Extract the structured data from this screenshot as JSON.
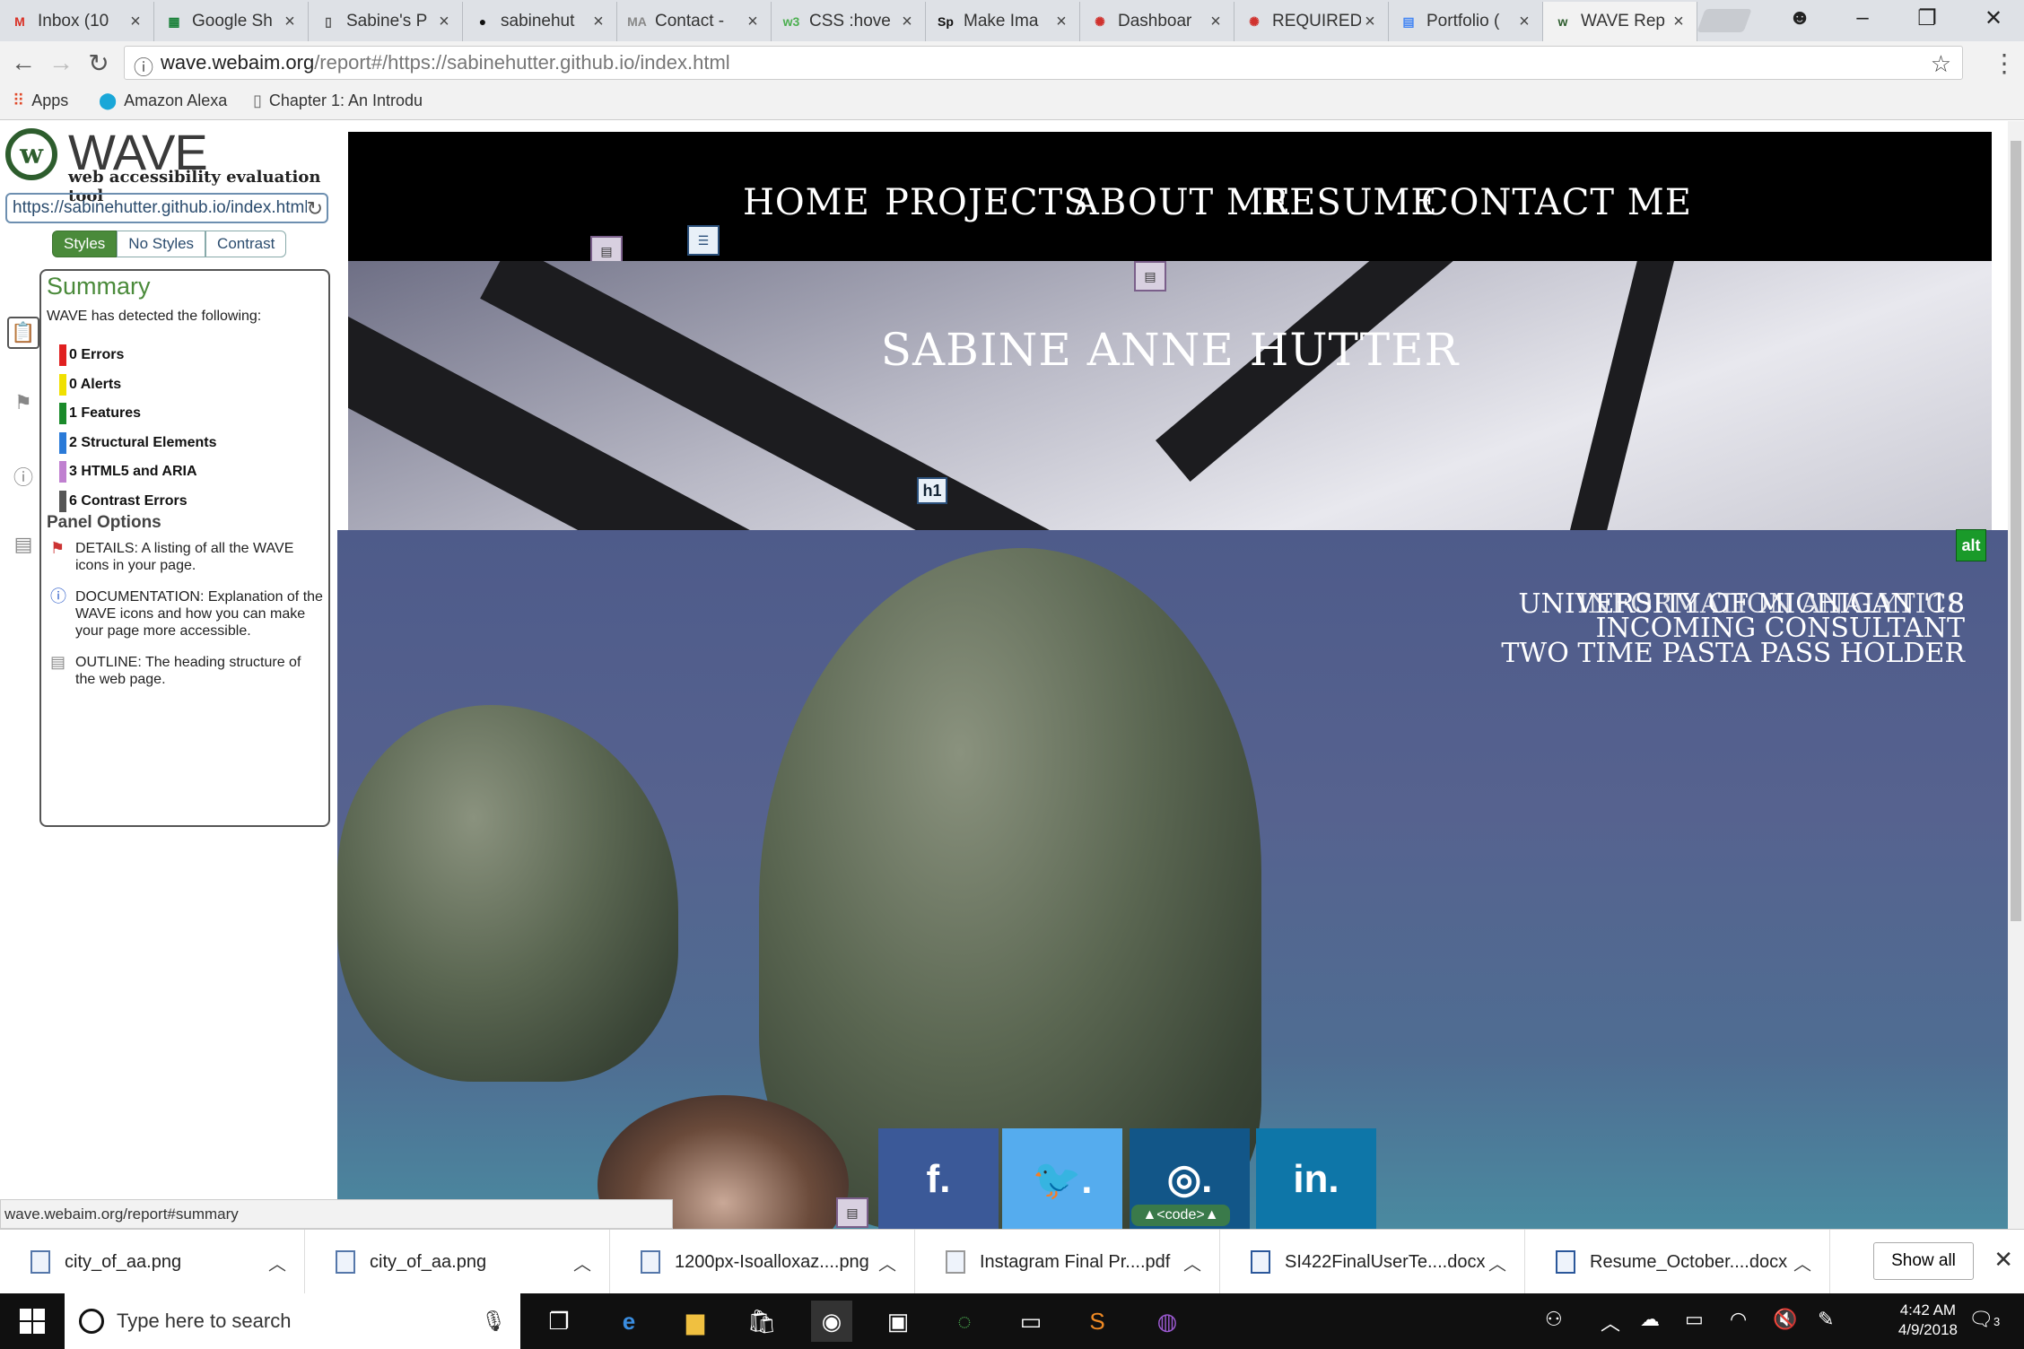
{
  "browser": {
    "tabs": [
      {
        "label": "Inbox (10",
        "icon": "gmail-icon",
        "color": "#d93025",
        "glyph": "M"
      },
      {
        "label": "Google Sh",
        "icon": "sheets-icon",
        "color": "#188038",
        "glyph": "▦"
      },
      {
        "label": "Sabine's P",
        "icon": "page-icon",
        "color": "#555555",
        "glyph": "▯"
      },
      {
        "label": "sabinehut",
        "icon": "github-icon",
        "color": "#111111",
        "glyph": "●"
      },
      {
        "label": "Contact -",
        "icon": "ma-icon",
        "color": "#888888",
        "glyph": "MA"
      },
      {
        "label": "CSS :hove",
        "icon": "w3-icon",
        "color": "#4caf50",
        "glyph": "w3"
      },
      {
        "label": "Make Ima",
        "icon": "sp-icon",
        "color": "#111111",
        "glyph": "Sp"
      },
      {
        "label": "Dashboar",
        "icon": "canvas-icon",
        "color": "#d0322e",
        "glyph": "✺"
      },
      {
        "label": "REQUIRED",
        "icon": "canvas-icon",
        "color": "#d0322e",
        "glyph": "✺"
      },
      {
        "label": "Portfolio (",
        "icon": "docs-icon",
        "color": "#4285f4",
        "glyph": "▤"
      },
      {
        "label": "WAVE Rep",
        "icon": "wave-icon",
        "color": "#2d5d2d",
        "glyph": "w"
      }
    ],
    "url_host": "wave.webaim.org",
    "url_path": "/report#/https://sabinehutter.github.io/index.html",
    "bookmarks": [
      {
        "label": "Apps",
        "icon": "apps-grid-icon"
      },
      {
        "label": "Amazon Alexa",
        "icon": "alexa-pin-icon"
      },
      {
        "label": "Chapter 1: An Introdu",
        "icon": "page-icon"
      }
    ],
    "status_url": "wave.webaim.org/report#summary"
  },
  "wave": {
    "title": "WAVE",
    "subtitle": "web accessibility evaluation tool",
    "url_value": "https://sabinehutter.github.io/index.html",
    "view_tabs": [
      "Styles",
      "No Styles",
      "Contrast"
    ],
    "summary_title": "Summary",
    "detected_text": "WAVE has detected the following:",
    "results": [
      {
        "label": "0 Errors",
        "color": "#e02020"
      },
      {
        "label": "0 Alerts",
        "color": "#f0e000"
      },
      {
        "label": "1 Features",
        "color": "#1a8a2a"
      },
      {
        "label": "2 Structural Elements",
        "color": "#2a7ad8"
      },
      {
        "label": "3 HTML5 and ARIA",
        "color": "#c080d0"
      },
      {
        "label": "6 Contrast Errors",
        "color": "#555555"
      }
    ],
    "panel_options_title": "Panel Options",
    "panel_options": [
      {
        "text": "DETAILS: A listing of all the WAVE icons in your page.",
        "icon": "flag-icon"
      },
      {
        "text": "DOCUMENTATION: Explanation of the WAVE icons and how you can make your page more accessible.",
        "icon": "info-icon"
      },
      {
        "text": "OUTLINE: The heading structure of the web page.",
        "icon": "document-icon"
      }
    ]
  },
  "site": {
    "nav": [
      "HOME",
      "PROJECTS",
      "ABOUT ME",
      "RESUME",
      "CONTACT ME"
    ],
    "name": "SABINE ANNE HUTTER",
    "taglines": [
      "UNIVERSITY OF MICHIGAN '18",
      "INFORMATION ANALYTICS",
      "INCOMING CONSULTANT",
      "TWO TIME PASTA PASS HOLDER"
    ],
    "social": [
      {
        "label": "f.",
        "icon": "facebook-icon",
        "color": "#3b5998"
      },
      {
        "label": "🐦.",
        "icon": "twitter-icon",
        "color": "#55acee"
      },
      {
        "label": "◎.",
        "icon": "instagram-icon",
        "color": "#125688"
      },
      {
        "label": "in.",
        "icon": "linkedin-icon",
        "color": "#0e76a8"
      }
    ],
    "wave_tags": {
      "alt": "alt",
      "h1": "h1",
      "code": "<code>"
    }
  },
  "downloads": [
    {
      "name": "city_of_aa.png"
    },
    {
      "name": "city_of_aa.png"
    },
    {
      "name": "1200px-Isoalloxaz....png"
    },
    {
      "name": "Instagram Final Pr....pdf"
    },
    {
      "name": "SI422FinalUserTe....docx"
    },
    {
      "name": "Resume_October....docx"
    }
  ],
  "show_all": "Show all",
  "taskbar": {
    "search_placeholder": "Type here to search",
    "time": "4:42 AM",
    "date": "4/9/2018",
    "notifications": "3"
  }
}
